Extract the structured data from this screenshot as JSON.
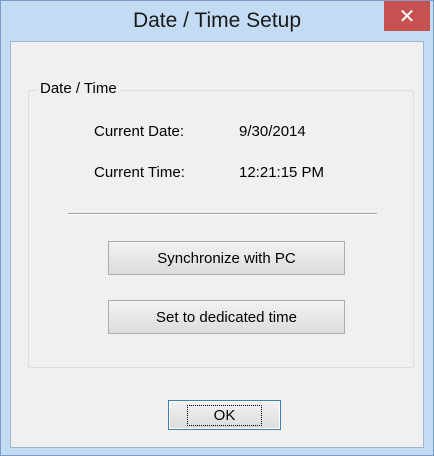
{
  "window": {
    "title": "Date / Time Setup",
    "close_symbol": "✕"
  },
  "group": {
    "legend": "Date / Time",
    "current_date_label": "Current Date:",
    "current_date_value": "9/30/2014",
    "current_time_label": "Current Time:",
    "current_time_value": "12:21:15 PM"
  },
  "buttons": {
    "sync_label": "Synchronize with PC",
    "dedicated_label": "Set to dedicated time",
    "ok_label": "OK"
  },
  "icons": {
    "close": "close-icon"
  },
  "colors": {
    "frame": "#c4dcf3",
    "close_button": "#c75050",
    "client_bg": "#f0f0f0"
  }
}
